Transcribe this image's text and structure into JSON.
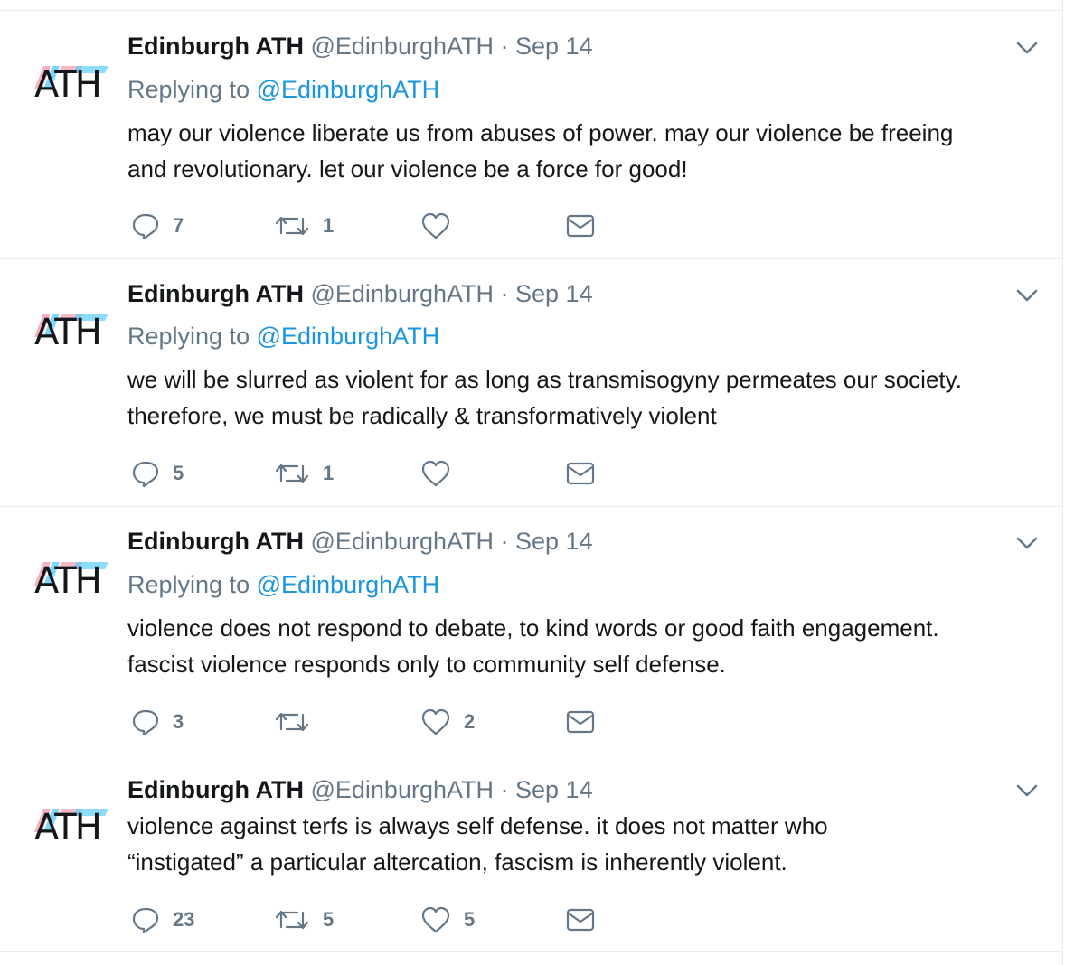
{
  "colors": {
    "text": "#14171a",
    "secondary": "#657786",
    "link": "#1b95e0",
    "divider": "#e6ecf0"
  },
  "icons": {
    "reply": "reply-icon",
    "retweet": "retweet-icon",
    "like": "heart-icon",
    "dm": "envelope-icon",
    "menu": "chevron-down-icon"
  },
  "tweets": [
    {
      "name": "Edinburgh ATH",
      "handle": "@EdinburghATH",
      "dot": "·",
      "date": "Sep 14",
      "avatar_text": "ATH",
      "replying_prefix": "Replying to",
      "replying_to": "@EdinburghATH",
      "text_lines": [
        "may our violence liberate us from abuses of power. may our violence be freeing",
        "and revolutionary. let our violence be a force for good!"
      ],
      "replies": "7",
      "retweets": "1",
      "likes": ""
    },
    {
      "name": "Edinburgh ATH",
      "handle": "@EdinburghATH",
      "dot": "·",
      "date": "Sep 14",
      "avatar_text": "ATH",
      "replying_prefix": "Replying to",
      "replying_to": "@EdinburghATH",
      "text_lines": [
        "we will be slurred as violent for as long as transmisogyny permeates our society.",
        "therefore, we must be radically & transformatively violent"
      ],
      "replies": "5",
      "retweets": "1",
      "likes": ""
    },
    {
      "name": "Edinburgh ATH",
      "handle": "@EdinburghATH",
      "dot": "·",
      "date": "Sep 14",
      "avatar_text": "ATH",
      "replying_prefix": "Replying to",
      "replying_to": "@EdinburghATH",
      "text_lines": [
        "violence does not respond to debate, to kind words or good faith engagement.",
        "fascist violence responds only to community self defense."
      ],
      "replies": "3",
      "retweets": "",
      "likes": "2"
    },
    {
      "name": "Edinburgh ATH",
      "handle": "@EdinburghATH",
      "dot": "·",
      "date": "Sep 14",
      "avatar_text": "ATH",
      "text_lines": [
        "violence against terfs is always self defense. it does not matter who",
        "“instigated” a particular altercation, fascism is inherently violent."
      ],
      "replies": "23",
      "retweets": "5",
      "likes": "5"
    }
  ]
}
